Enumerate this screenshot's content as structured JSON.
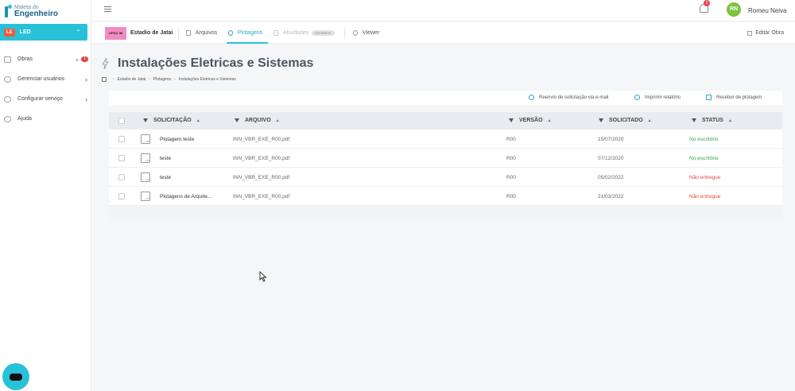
{
  "sidebar": {
    "logo": {
      "line1": "Maleta do",
      "line2": "Engenheiro"
    },
    "company": {
      "badge": "LE",
      "name": "LED",
      "chevron": "⌃"
    },
    "items": [
      {
        "label": "Obras",
        "count": "1",
        "icon": "building-icon"
      },
      {
        "label": "Gerenciar usuários",
        "icon": "users-icon"
      },
      {
        "label": "Configurar serviço",
        "icon": "gear-icon"
      },
      {
        "label": "Ajuda",
        "icon": "help-icon"
      }
    ]
  },
  "topbar": {
    "notifications": "2",
    "avatar": "RN",
    "username": "Romeu Neiva"
  },
  "project": {
    "thumb": "UPDO IM",
    "name": "Estadio de Jatai",
    "tabs": [
      {
        "label": "Arquivos"
      },
      {
        "label": "Plotagens"
      },
      {
        "label": "Atividades",
        "badge": "EM BREVE"
      },
      {
        "label": "Viewer"
      }
    ],
    "edit": "Editar Obra"
  },
  "main": {
    "title": "Instalações Eletricas e Sistemas",
    "breadcrumb": [
      "Estadio de Jatai",
      "Plotagens",
      "Instalações Eletricas e Sistemas"
    ],
    "actions": [
      "Reenvio de solicitação via e-mail",
      "Imprimir relatório",
      "Receber de plotagem"
    ],
    "columns": {
      "solicitacao": "SOLICITAÇÃO",
      "arquivo": "ARQUIVO",
      "versao": "VERSÃO",
      "solicitado": "SOLICITADO",
      "status": "STATUS",
      "sort": "▲"
    },
    "rows": [
      {
        "solicitacao": "Plotagem teste",
        "arquivo": "INN_VBR_EXE_R00.pdf",
        "versao": "R00",
        "solicitado": "15/07/2020",
        "status": "No escritório",
        "ok": true
      },
      {
        "solicitacao": "teste",
        "arquivo": "INN_VBR_EXE_R00.pdf",
        "versao": "R00",
        "solicitado": "07/12/2020",
        "status": "No escritório",
        "ok": true
      },
      {
        "solicitacao": "teste",
        "arquivo": "INN_VBR_EXE_R00.pdf",
        "versao": "R00",
        "solicitado": "05/02/2022",
        "status": "Não entregue",
        "ok": false
      },
      {
        "solicitacao": "Plotagens de Arquite...",
        "arquivo": "INN_VBR_EXE_R00.pdf",
        "versao": "R00",
        "solicitado": "21/03/2022",
        "status": "Não entregue",
        "ok": false
      }
    ]
  },
  "colors": {
    "accent": "#29c1d8",
    "ok": "#2ea84a",
    "danger": "#e2483c",
    "badge": "#ef5a3c"
  }
}
